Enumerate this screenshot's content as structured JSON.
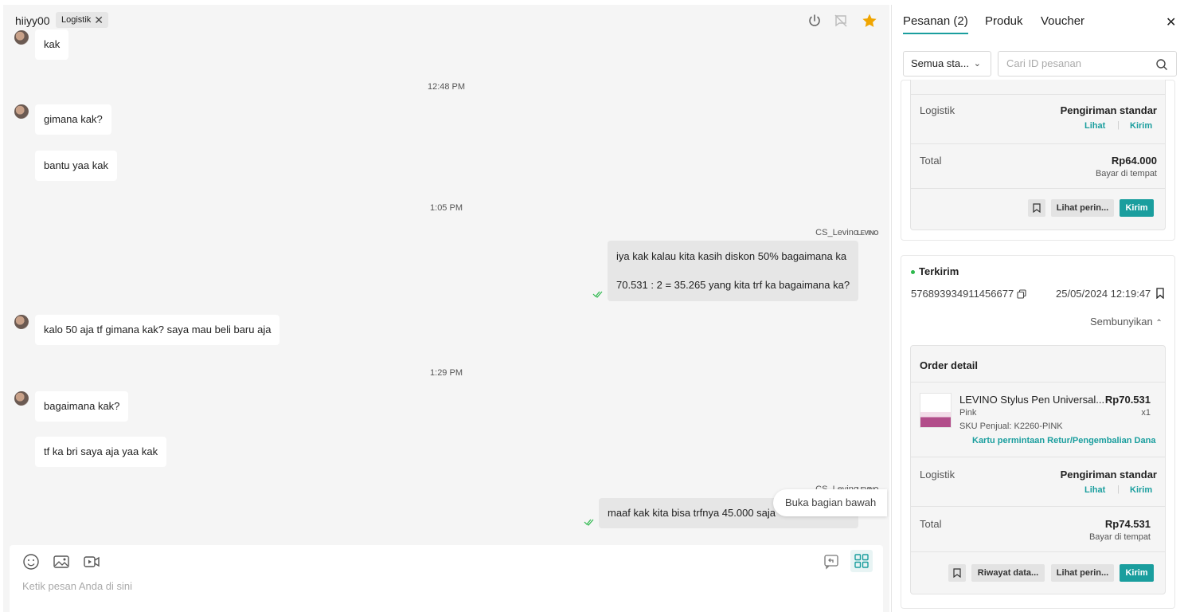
{
  "chat": {
    "header": {
      "user_name": "hiiyy00",
      "tag_label": "Logistik",
      "tag_remove": "✕"
    },
    "messages": {
      "m1": "kak",
      "t1": "12:48 PM",
      "m2": "gimana kak?",
      "m3": "bantu yaa kak",
      "t2": "1:05 PM",
      "o1_sender": "CS_Levino",
      "o1_logo": "LEVINO",
      "o1_line1": "iya kak kalau kita kasih diskon 50% bagaimana ka",
      "o1_line2": "70.531 : 2 = 35.265 yang kita trf ka bagaimana ka?",
      "m4": "kalo 50 aja tf gimana kak? saya mau beli baru aja",
      "t3": "1:29 PM",
      "m5": "bagaimana kak?",
      "m6": "tf ka bri saya aja yaa kak",
      "o2_sender": "CS_Levino",
      "o2_logo": "LEVINO",
      "o2_line1": "maaf kak kita bisa trfnya 45.000 saja"
    },
    "scroll_pill": "Buka bagian bawah",
    "composer": {
      "placeholder": "Ketik pesan Anda di sini"
    }
  },
  "panel": {
    "tabs": [
      "Pesanan (2)",
      "Produk",
      "Voucher"
    ],
    "close": "✕",
    "filter": {
      "selected": "Semua sta...",
      "search_placeholder": "Cari ID pesanan"
    },
    "order1": {
      "logistic_label": "Logistik",
      "logistic_value": "Pengiriman standar",
      "link_view": "Lihat",
      "link_send": "Kirim",
      "total_label": "Total",
      "total_value": "Rp64.000",
      "payment": "Bayar di tempat",
      "btn_detail": "Lihat perin...",
      "btn_send": "Kirim"
    },
    "order2": {
      "status": "Terkirim",
      "order_id": "576893934911456677",
      "date": "25/05/2024 12:19:47",
      "toggle": "Sembunyikan",
      "detail_title": "Order detail",
      "product_name": "LEVINO Stylus Pen Universal...",
      "product_price": "Rp70.531",
      "variant": "Pink",
      "qty": "x1",
      "sku": "SKU Penjual: K2260-PINK",
      "return_link": "Kartu permintaan Retur/Pengembalian Dana",
      "logistic_label": "Logistik",
      "logistic_value": "Pengiriman standar",
      "link_view": "Lihat",
      "link_send": "Kirim",
      "total_label": "Total",
      "total_value": "Rp74.531",
      "payment": "Bayar di tempat",
      "btn_history": "Riwayat data...",
      "btn_detail": "Lihat perin...",
      "btn_send": "Kirim"
    }
  },
  "colors": {
    "accent": "#1a9e9e",
    "star": "#f0a500",
    "status_dot": "#2db84d"
  }
}
